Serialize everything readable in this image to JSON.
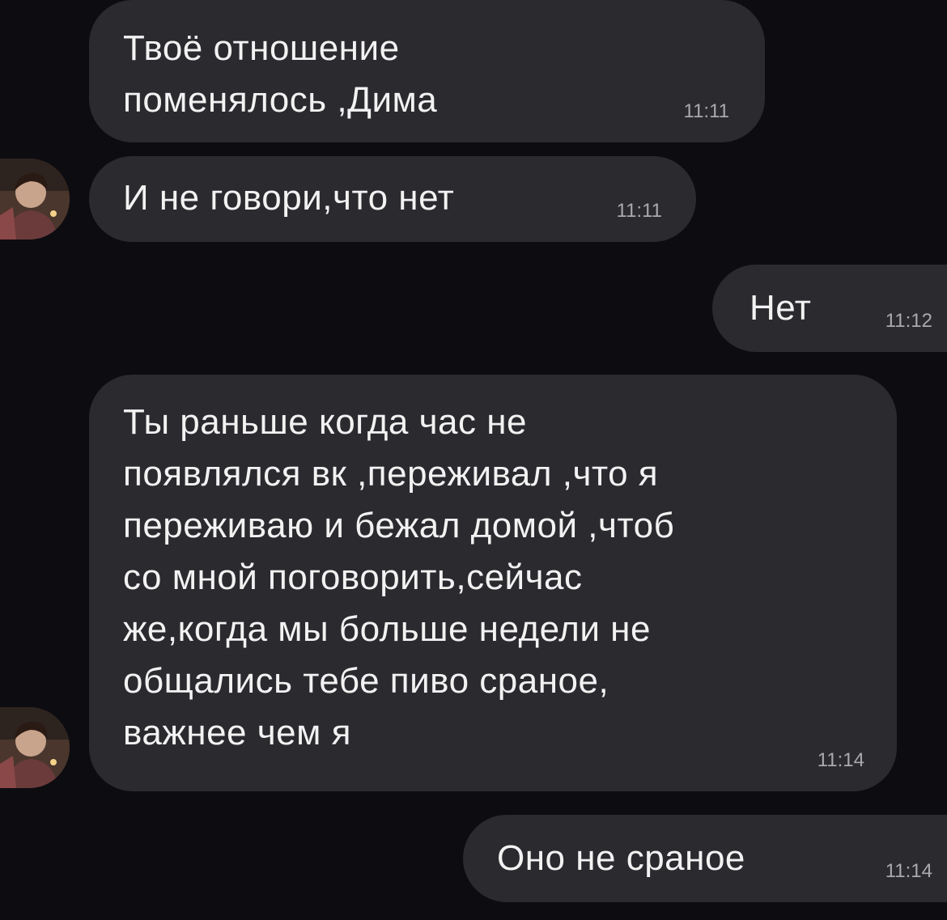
{
  "messages": [
    {
      "direction": "incoming",
      "text": "Твоё отношение\nпоменялось ,Дима",
      "time": "11:11"
    },
    {
      "direction": "incoming",
      "text": "И не говори,что нет",
      "time": "11:11"
    },
    {
      "direction": "outgoing",
      "text": "Нет",
      "time": "11:12"
    },
    {
      "direction": "incoming",
      "text": "Ты раньше когда час не\nпоявлялся вк ,переживал ,что я\nпереживаю и бежал домой ,чтоб\nсо мной поговорить,сейчас\nже,когда мы больше недели не\nобщались тебе пиво сраное,\nважнее чем я",
      "time": "11:14"
    },
    {
      "direction": "outgoing",
      "text": "Оно не сраное",
      "time": "11:14"
    }
  ],
  "colors": {
    "background": "#0d0c11",
    "bubble": "#2a2a2f",
    "text": "#f2f2f2",
    "timestamp": "#a9a9ae"
  },
  "icons": {
    "avatar": "contact-avatar-photo"
  }
}
